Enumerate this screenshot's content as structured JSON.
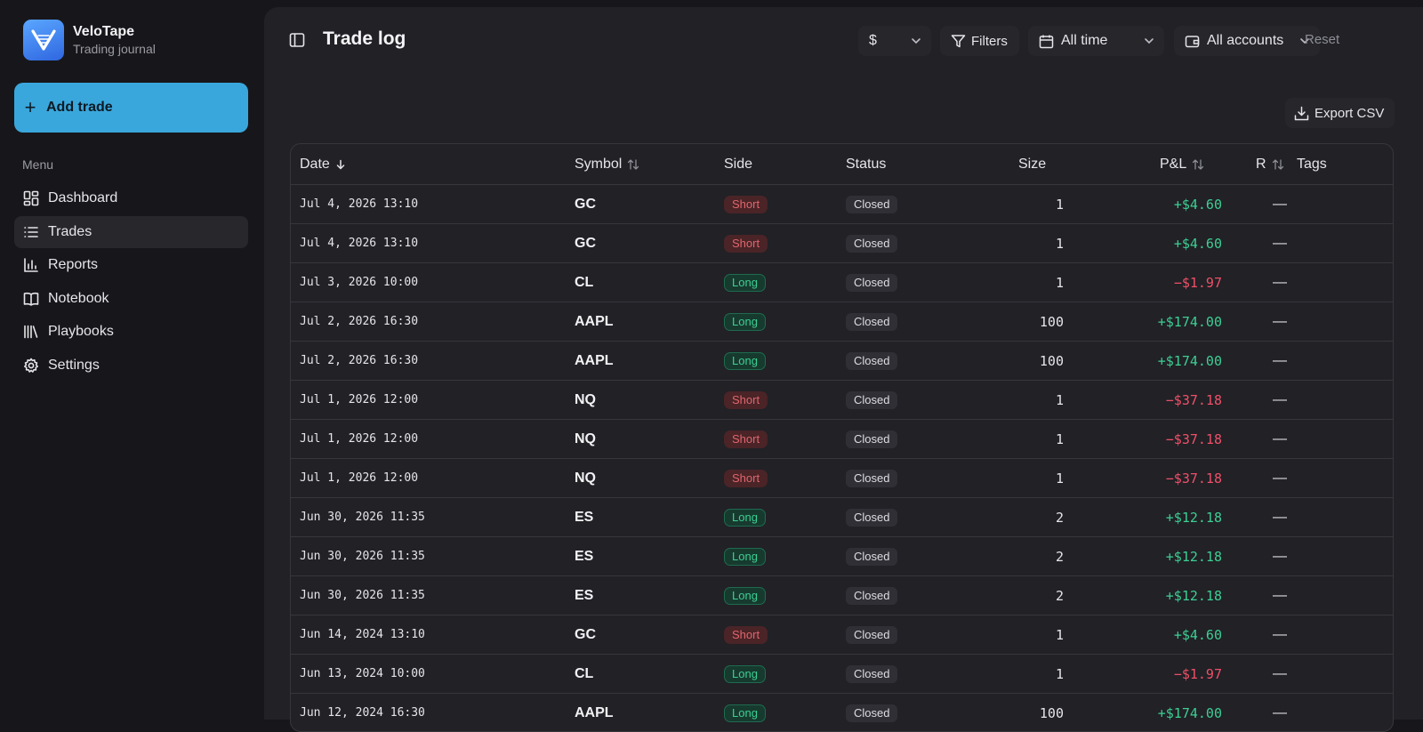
{
  "brand": {
    "name": "VeloTape",
    "subtitle": "Trading journal"
  },
  "sidebar": {
    "add_button": "Add trade",
    "menu_label": "Menu",
    "items": [
      {
        "label": "Dashboard",
        "icon": "dashboard-icon"
      },
      {
        "label": "Trades",
        "icon": "list-icon",
        "active": true
      },
      {
        "label": "Reports",
        "icon": "bar-chart-icon"
      },
      {
        "label": "Notebook",
        "icon": "book-icon"
      },
      {
        "label": "Playbooks",
        "icon": "library-icon"
      },
      {
        "label": "Settings",
        "icon": "gear-icon"
      }
    ]
  },
  "header": {
    "title": "Trade log",
    "currency": "$",
    "filters_label": "Filters",
    "range": "All time",
    "accounts": "All accounts",
    "reset_label": "Reset",
    "export_label": "Export CSV"
  },
  "table": {
    "columns": {
      "date": "Date",
      "symbol": "Symbol",
      "side": "Side",
      "status": "Status",
      "size": "Size",
      "pnl": "P&L",
      "r": "R",
      "tags": "Tags"
    },
    "rows": [
      {
        "date": "Jul 4, 2026 13:10",
        "symbol": "GC",
        "side": "Short",
        "status": "Closed",
        "size": "1",
        "pnl": "+$4.60",
        "r": "—"
      },
      {
        "date": "Jul 4, 2026 13:10",
        "symbol": "GC",
        "side": "Short",
        "status": "Closed",
        "size": "1",
        "pnl": "+$4.60",
        "r": "—"
      },
      {
        "date": "Jul 3, 2026 10:00",
        "symbol": "CL",
        "side": "Long",
        "status": "Closed",
        "size": "1",
        "pnl": "−$1.97",
        "r": "—"
      },
      {
        "date": "Jul 2, 2026 16:30",
        "symbol": "AAPL",
        "side": "Long",
        "status": "Closed",
        "size": "100",
        "pnl": "+$174.00",
        "r": "—"
      },
      {
        "date": "Jul 2, 2026 16:30",
        "symbol": "AAPL",
        "side": "Long",
        "status": "Closed",
        "size": "100",
        "pnl": "+$174.00",
        "r": "—"
      },
      {
        "date": "Jul 1, 2026 12:00",
        "symbol": "NQ",
        "side": "Short",
        "status": "Closed",
        "size": "1",
        "pnl": "−$37.18",
        "r": "—"
      },
      {
        "date": "Jul 1, 2026 12:00",
        "symbol": "NQ",
        "side": "Short",
        "status": "Closed",
        "size": "1",
        "pnl": "−$37.18",
        "r": "—"
      },
      {
        "date": "Jul 1, 2026 12:00",
        "symbol": "NQ",
        "side": "Short",
        "status": "Closed",
        "size": "1",
        "pnl": "−$37.18",
        "r": "—"
      },
      {
        "date": "Jun 30, 2026 11:35",
        "symbol": "ES",
        "side": "Long",
        "status": "Closed",
        "size": "2",
        "pnl": "+$12.18",
        "r": "—"
      },
      {
        "date": "Jun 30, 2026 11:35",
        "symbol": "ES",
        "side": "Long",
        "status": "Closed",
        "size": "2",
        "pnl": "+$12.18",
        "r": "—"
      },
      {
        "date": "Jun 30, 2026 11:35",
        "symbol": "ES",
        "side": "Long",
        "status": "Closed",
        "size": "2",
        "pnl": "+$12.18",
        "r": "—"
      },
      {
        "date": "Jun 14, 2024 13:10",
        "symbol": "GC",
        "side": "Short",
        "status": "Closed",
        "size": "1",
        "pnl": "+$4.60",
        "r": "—"
      },
      {
        "date": "Jun 13, 2024 10:00",
        "symbol": "CL",
        "side": "Long",
        "status": "Closed",
        "size": "1",
        "pnl": "−$1.97",
        "r": "—"
      },
      {
        "date": "Jun 12, 2024 16:30",
        "symbol": "AAPL",
        "side": "Long",
        "status": "Closed",
        "size": "100",
        "pnl": "+$174.00",
        "r": "—"
      }
    ]
  },
  "colors": {
    "accent": "#3aa7dc",
    "positive": "#3dcf93",
    "negative": "#ef5068",
    "panel": "#212126",
    "background": "#17171b"
  }
}
